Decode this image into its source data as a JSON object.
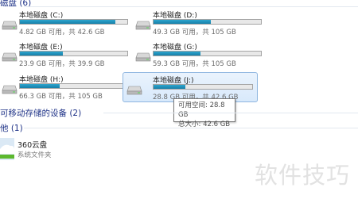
{
  "sections": {
    "hard_disks": "磁盘 (6)",
    "removable": "可移动存储的设备 (2)",
    "other": "他 (1)"
  },
  "drives": [
    {
      "name": "本地磁盘 (C:)",
      "free": "4.82 GB 可用，共 42.6 GB",
      "used_fraction": 0.89
    },
    {
      "name": "本地磁盘 (D:)",
      "free": "49.3 GB 可用，共 105 GB",
      "used_fraction": 0.53
    },
    {
      "name": "本地磁盘 (E:)",
      "free": "23.9 GB 可用，共 39.9 GB",
      "used_fraction": 0.4
    },
    {
      "name": "本地磁盘 (G:)",
      "free": "59.3 GB 可用，共 105 GB",
      "used_fraction": 0.44
    },
    {
      "name": "本地磁盘 (H:)",
      "free": "66.3 GB 可用，共 105 GB",
      "used_fraction": 0.37
    },
    {
      "name": "本地磁盘 (J:)",
      "free": "28.8 GB 可用，共 42.6 GB",
      "used_fraction": 0.32
    }
  ],
  "tooltip": {
    "free_space": "可用空间: 28.8 GB",
    "total_size": "总大小: 42.6 GB"
  },
  "other_items": [
    {
      "name": "360云盘",
      "subtitle": "系统文件夹",
      "icon": "cloud-drive-icon"
    }
  ],
  "watermark": "软件技巧",
  "colors": {
    "bar_fill": "#2196c4",
    "section_heading": "#1e3287"
  }
}
